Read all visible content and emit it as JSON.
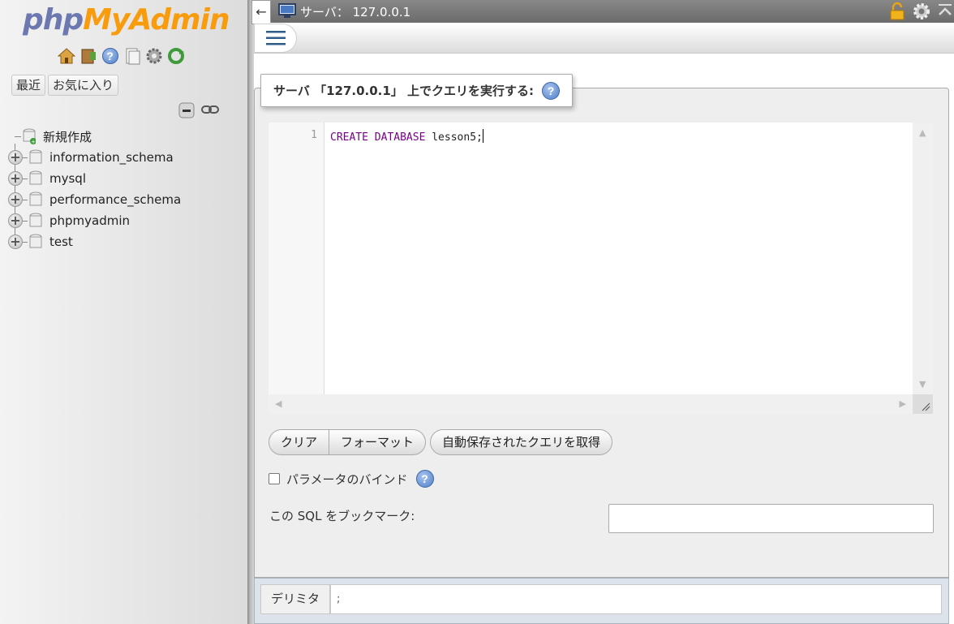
{
  "logo": {
    "part1": "php",
    "part2": "MyAdmin"
  },
  "nav": {
    "icons": [
      "home-icon",
      "exit-icon",
      "help-icon",
      "docs-icon",
      "settings-icon",
      "reload-icon"
    ],
    "tabs": [
      "最近",
      "お気に入り"
    ],
    "tree_tools": [
      "collapse-all-icon",
      "link-icon"
    ],
    "new_item": "新規作成",
    "databases": [
      "information_schema",
      "mysql",
      "performance_schema",
      "phpmyadmin",
      "test"
    ]
  },
  "topbar": {
    "back": "←",
    "server_label": "サーバ： 127.0.0.1",
    "right_icons": [
      "lock-icon",
      "gear-icon",
      "collapse-icon"
    ]
  },
  "query": {
    "legend": "サーバ 「127.0.0.1」 上でクエリを実行する:",
    "line_number": "1",
    "code_kw": "CREATE DATABASE",
    "code_rest": " lesson5;",
    "btn_clear": "クリア",
    "btn_format": "フォーマット",
    "btn_autosave": "自動保存されたクエリを取得",
    "bind_label": "パラメータのバインド",
    "bookmark_label": "この SQL をブックマーク:",
    "bookmark_value": "",
    "delimiter_label": "デリミタ",
    "delimiter_value": ";"
  },
  "colors": {
    "logo_php": "#6c78af",
    "logo_myadmin": "#f89c0e",
    "sql_keyword": "#770088",
    "topbar": "#7a7a7a"
  }
}
